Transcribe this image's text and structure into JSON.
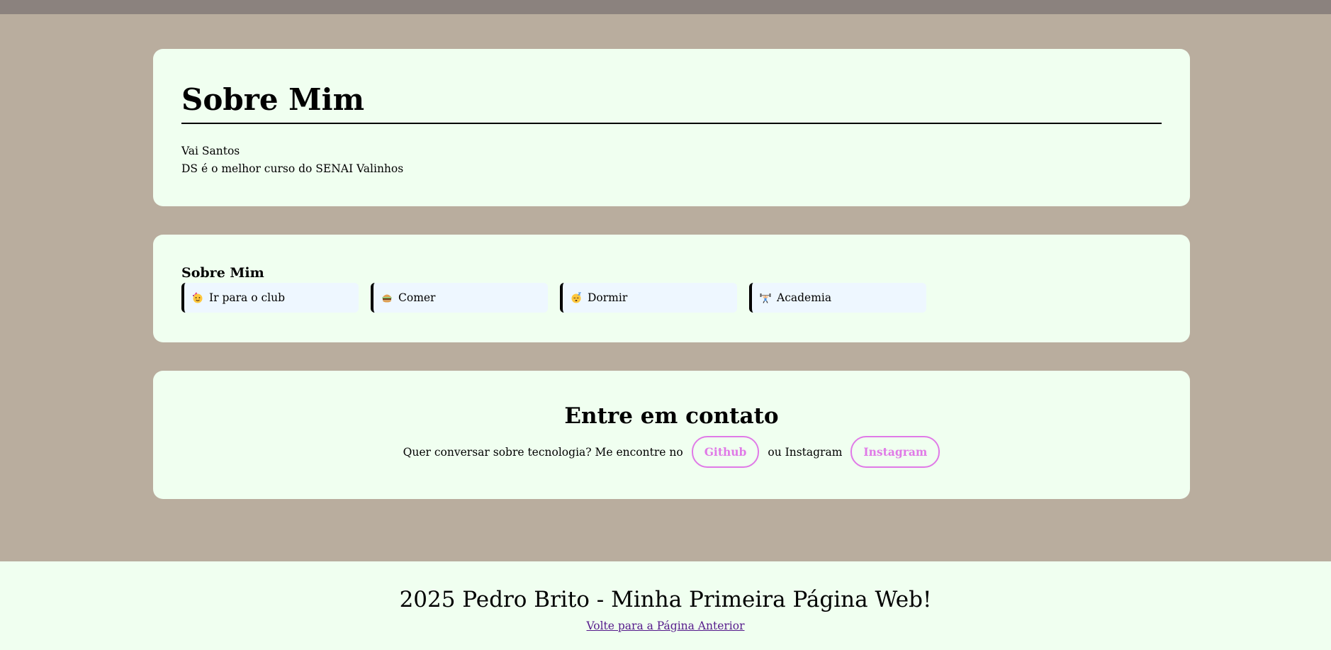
{
  "about": {
    "title": "Sobre Mim",
    "lines": [
      "Vai Santos",
      "DS é o melhor curso do SENAI Valinhos"
    ]
  },
  "hobbies": {
    "title": "Sobre Mim",
    "items": [
      {
        "icon": "party-face-icon",
        "label": "Ir para o club"
      },
      {
        "icon": "hamburger-icon",
        "label": "Comer"
      },
      {
        "icon": "sleeping-face-icon",
        "label": "Dormir"
      },
      {
        "icon": "weightlifter-icon",
        "label": "Academia"
      }
    ]
  },
  "contact": {
    "title": "Entre em contato",
    "text_before": "Quer conversar sobre tecnologia? Me encontre no",
    "github_label": "Github",
    "text_middle": "ou Instagram",
    "instagram_label": "Instagram"
  },
  "footer": {
    "title": "2025 Pedro Brito - Minha Primeira Página Web!",
    "link_label": "Volte para a Página Anterior"
  },
  "colors": {
    "page_background": "#b9ad9e",
    "card_background": "#f0fff0",
    "hobby_background": "#eef7ff",
    "accent_pink": "#e07ae7",
    "top_bar": "#8b827e",
    "visited_link": "#551a8b"
  }
}
